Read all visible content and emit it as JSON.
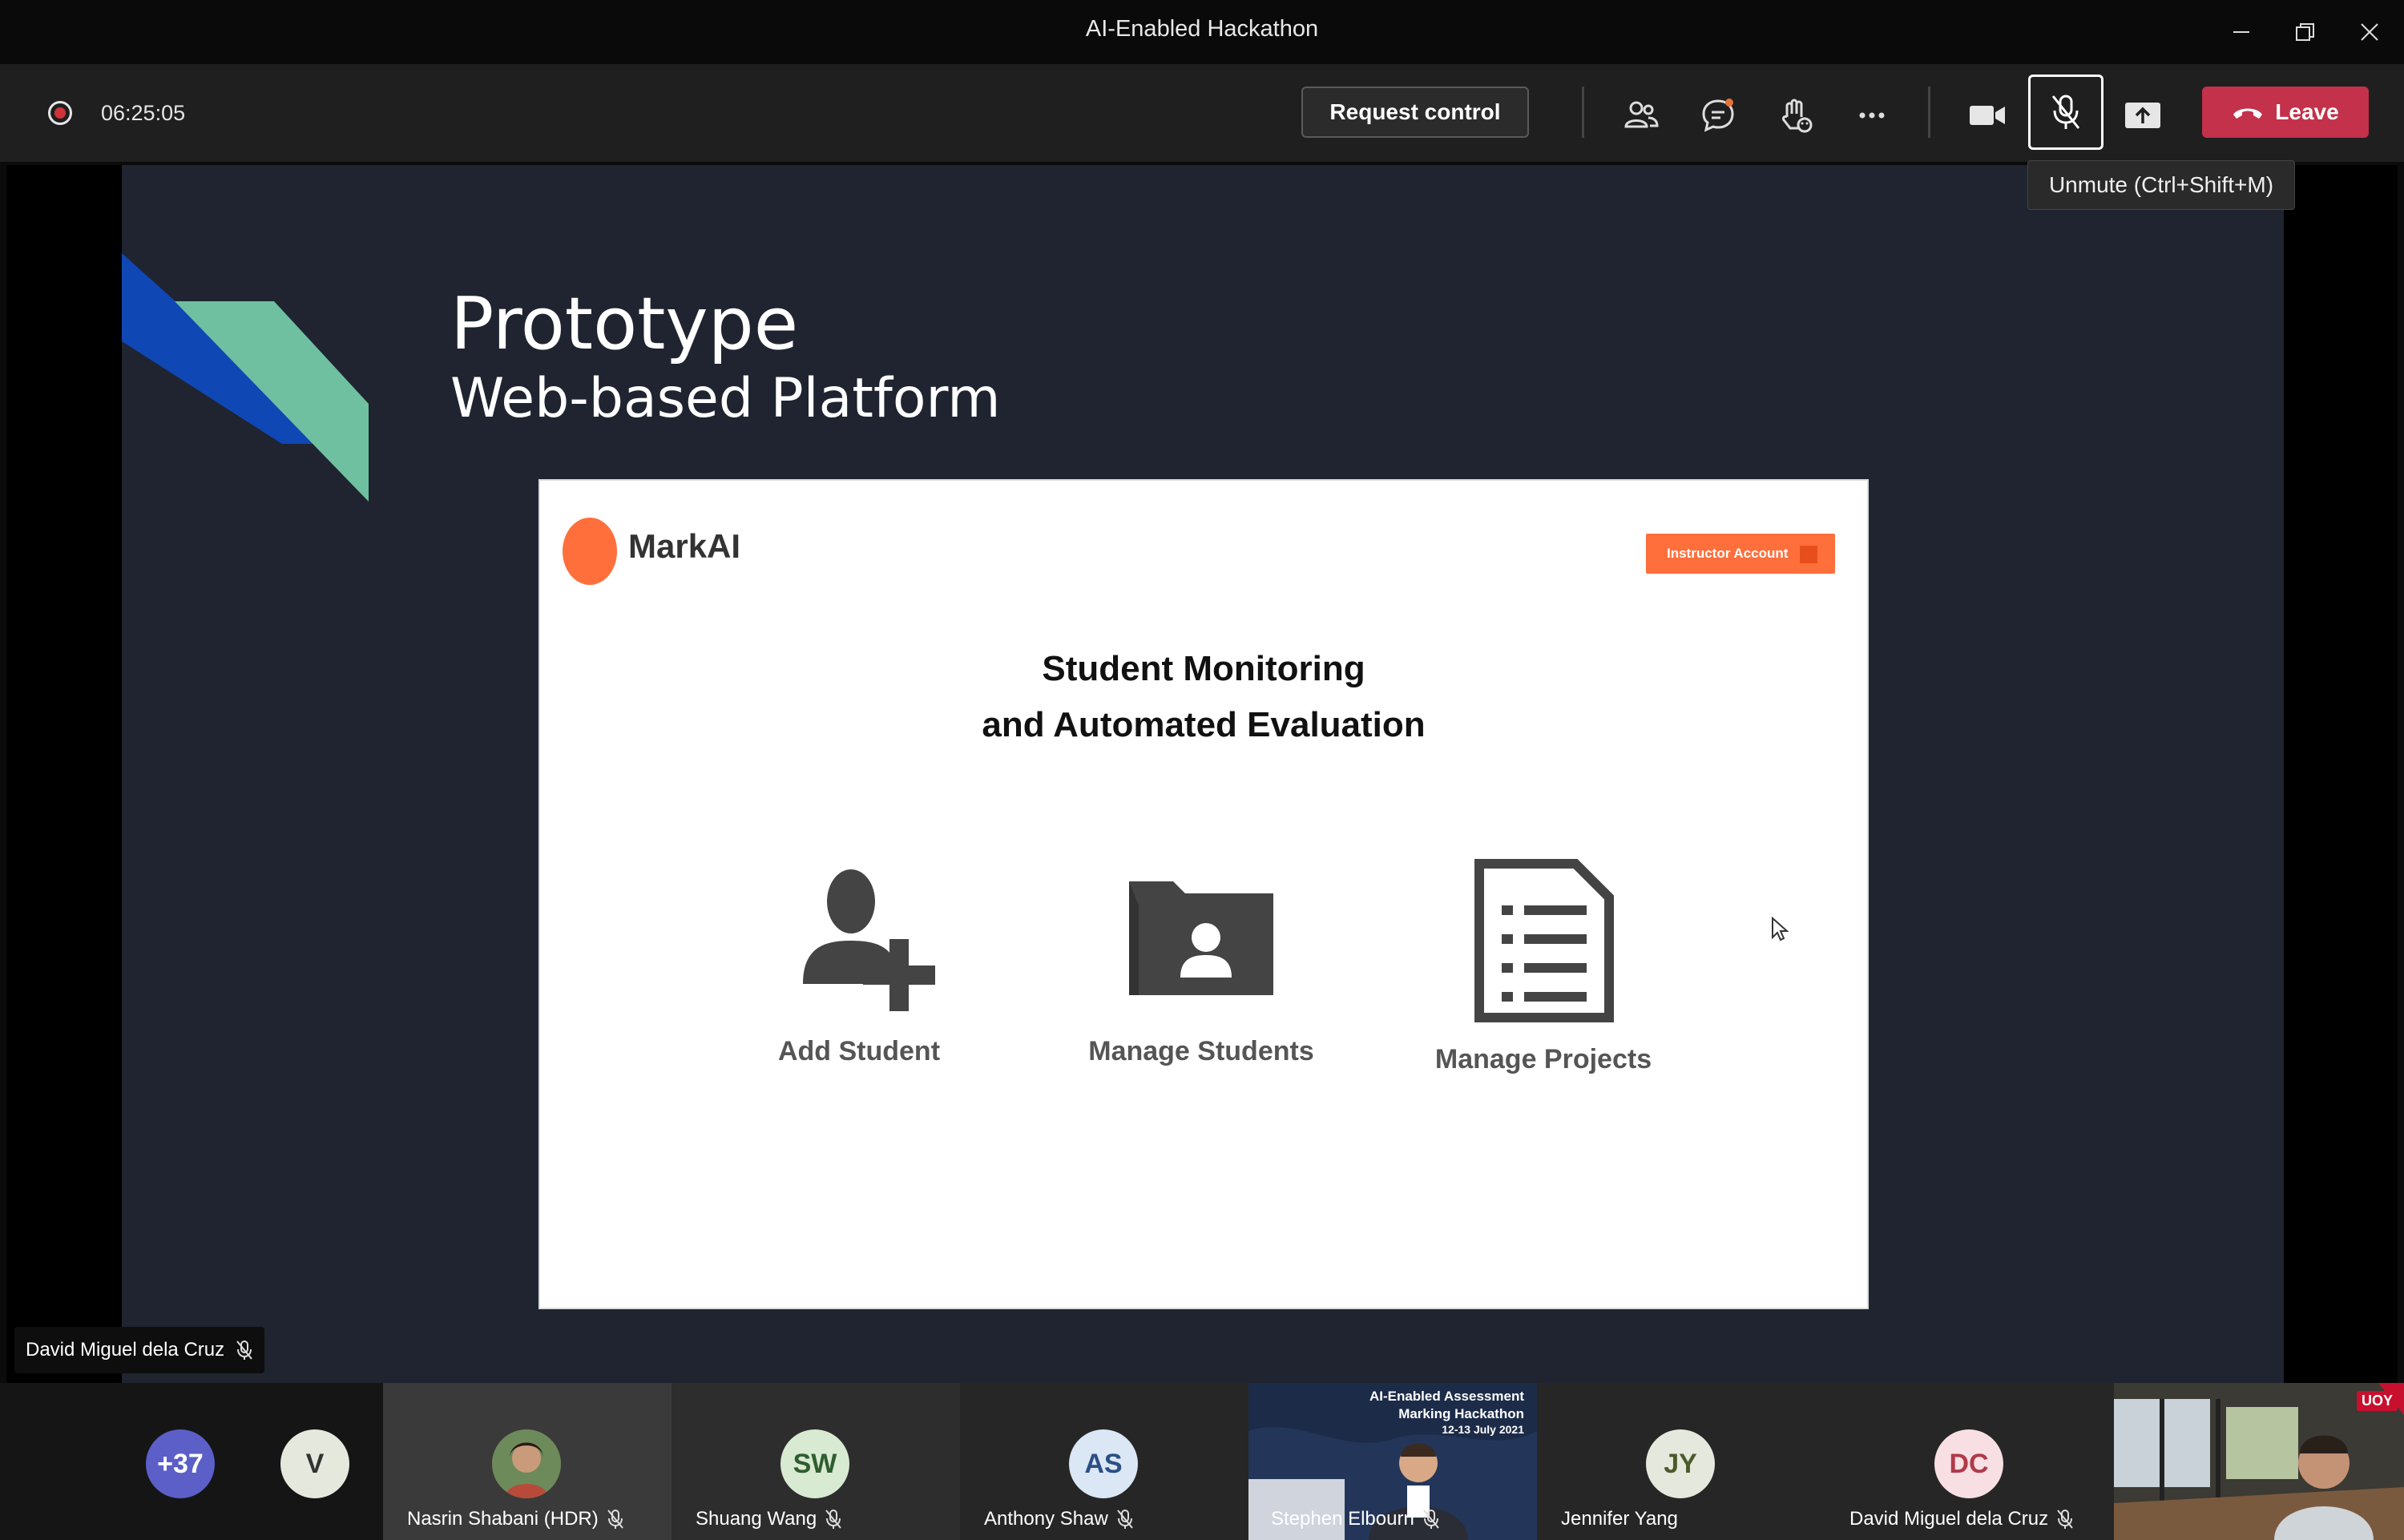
{
  "window": {
    "title": "AI-Enabled Hackathon"
  },
  "toolbar": {
    "timer": "06:25:05",
    "request_control_label": "Request control",
    "leave_label": "Leave",
    "tooltip": "Unmute (Ctrl+Shift+M)",
    "icons": [
      "record-icon",
      "people-icon",
      "chat-icon",
      "reactions-icon",
      "more-icon",
      "camera-icon",
      "mic-off-icon",
      "share-icon",
      "phone-icon"
    ],
    "leave_color": "#c4314b"
  },
  "slide": {
    "title": "Prototype",
    "subtitle": "Web-based Platform",
    "app": {
      "logo_text": "MarkAI",
      "account_button": "Instructor Account",
      "heading_line1": "Student Monitoring",
      "heading_line2": "and Automated Evaluation",
      "features": [
        {
          "label": "Add Student",
          "icon": "add-user-icon"
        },
        {
          "label": "Manage Students",
          "icon": "folder-user-icon"
        },
        {
          "label": "Manage Projects",
          "icon": "document-list-icon"
        }
      ],
      "accent": "#ff6f3c"
    }
  },
  "presenter": {
    "name": "David Miguel dela Cruz"
  },
  "participants": [
    {
      "initials": "+37",
      "name": ""
    },
    {
      "initials": "V",
      "name": ""
    },
    {
      "initials": "",
      "name": "Nasrin Shabani (HDR)"
    },
    {
      "initials": "SW",
      "name": "Shuang Wang"
    },
    {
      "initials": "AS",
      "name": "Anthony Shaw"
    },
    {
      "initials": "",
      "name": "Stephen Elbourn",
      "video_title": "AI-Enabled Assessment Marking Hackathon",
      "video_dates": "12-13 July 2021"
    },
    {
      "initials": "JY",
      "name": "Jennifer Yang"
    },
    {
      "initials": "DC",
      "name": "David Miguel dela Cruz"
    },
    {
      "initials": "",
      "name": "",
      "badge": "UOY"
    }
  ]
}
